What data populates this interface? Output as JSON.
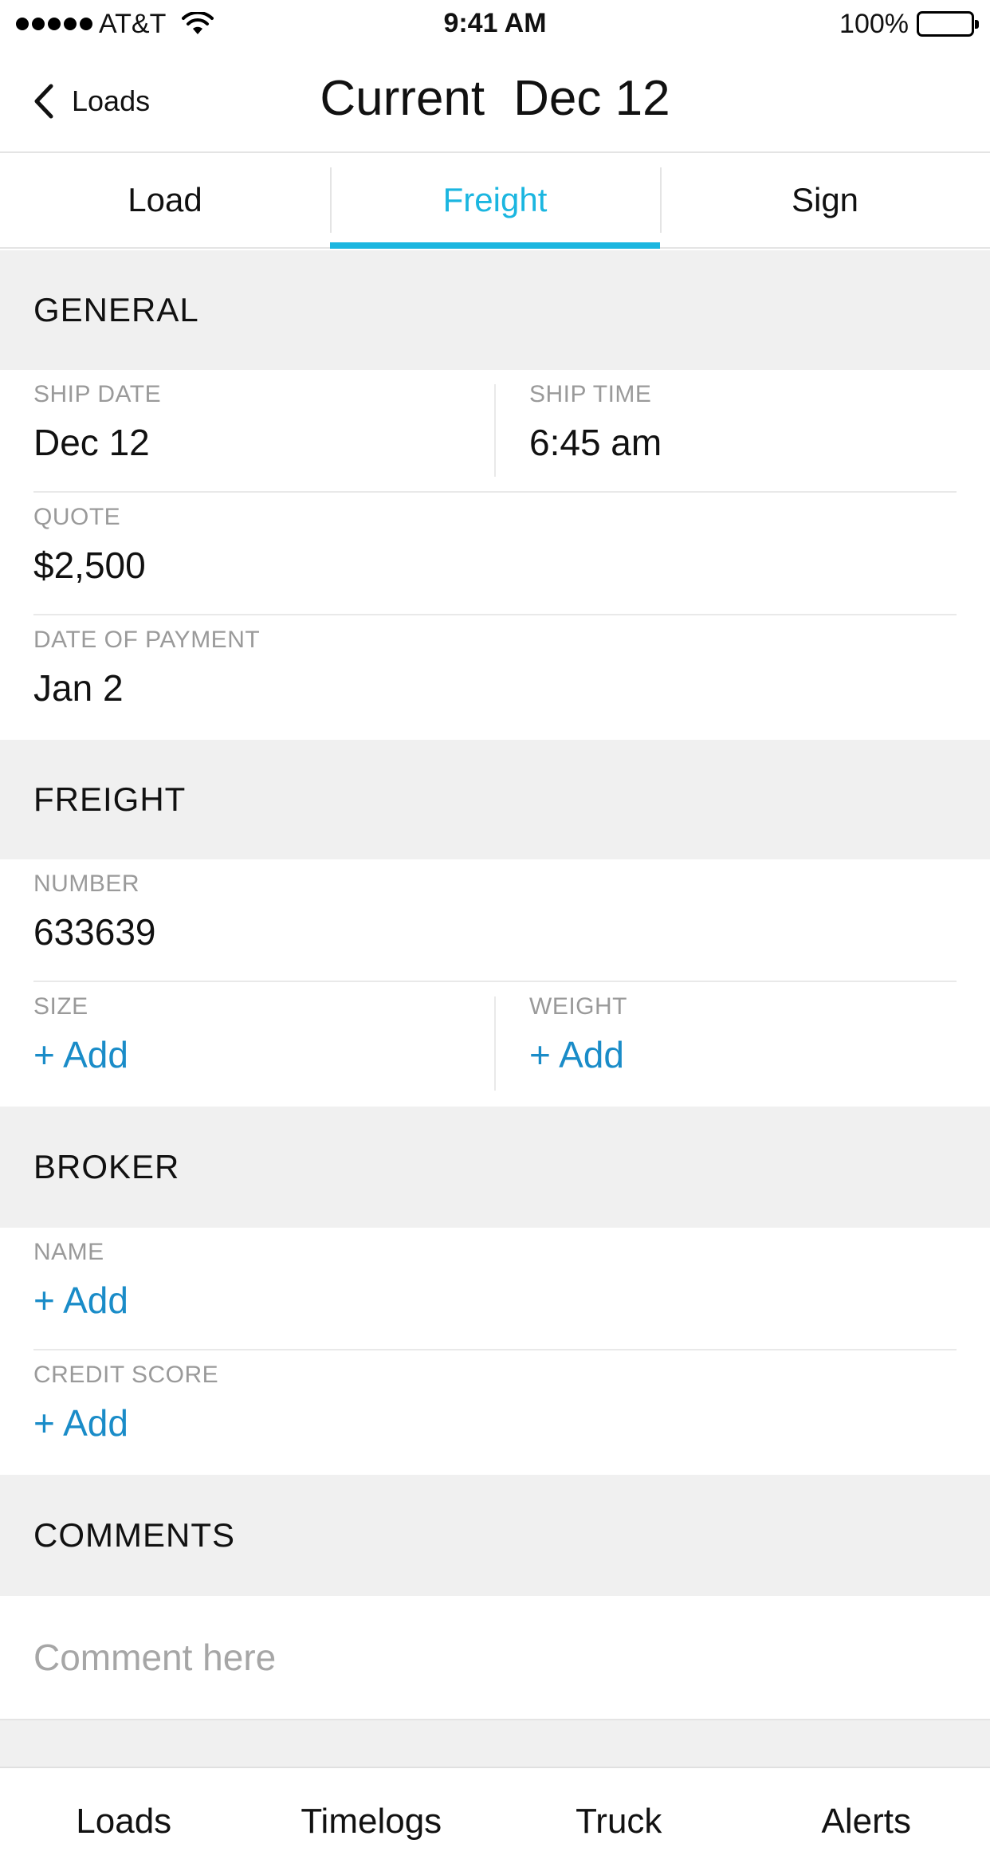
{
  "status_bar": {
    "carrier": "AT&T",
    "time": "9:41 AM",
    "battery": "100%",
    "signal_icon": "signal-dots-icon",
    "wifi_icon": "wifi-icon",
    "battery_icon": "battery-icon"
  },
  "nav": {
    "back_label": "Loads",
    "title_status": "Current",
    "title_date": "Dec 12"
  },
  "tabs": [
    {
      "label": "Load",
      "active": false
    },
    {
      "label": "Freight",
      "active": true
    },
    {
      "label": "Sign",
      "active": false
    }
  ],
  "sections": {
    "general": {
      "header": "GENERAL",
      "ship_date": {
        "label": "SHIP DATE",
        "value": "Dec 12"
      },
      "ship_time": {
        "label": "SHIP TIME",
        "value": "6:45 am"
      },
      "quote": {
        "label": "QUOTE",
        "value": "$2,500"
      },
      "date_of_payment": {
        "label": "DATE OF PAYMENT",
        "value": "Jan 2"
      }
    },
    "freight": {
      "header": "FREIGHT",
      "number": {
        "label": "NUMBER",
        "value": "633639"
      },
      "size": {
        "label": "SIZE",
        "value": "+ Add"
      },
      "weight": {
        "label": "WEIGHT",
        "value": "+ Add"
      }
    },
    "broker": {
      "header": "BROKER",
      "name": {
        "label": "NAME",
        "value": "+ Add"
      },
      "credit_score": {
        "label": "CREDIT SCORE",
        "value": "+ Add"
      }
    },
    "comments": {
      "header": "COMMENTS",
      "placeholder": "Comment here"
    }
  },
  "tab_bar": [
    {
      "label": "Loads"
    },
    {
      "label": "Timelogs"
    },
    {
      "label": "Truck"
    },
    {
      "label": "Alerts"
    }
  ],
  "colors": {
    "accent": "#1bb6e0",
    "link": "#1a8cc8",
    "section_bg": "#f0f0f0",
    "label_gray": "#9a9a9a"
  }
}
